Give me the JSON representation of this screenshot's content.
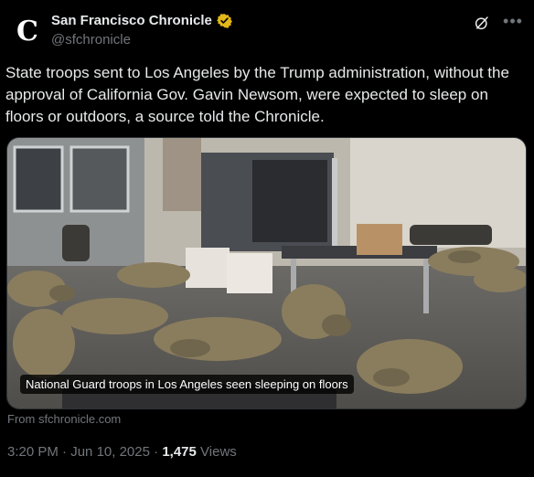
{
  "account": {
    "display_name": "San Francisco Chronicle",
    "handle": "@sfchronicle",
    "avatar_letter": "C",
    "verified": true,
    "verified_color": "#e2b719"
  },
  "icons": {
    "verified": "verified-badge-icon",
    "grok": "grok-icon",
    "more": "more-options-icon"
  },
  "post": {
    "text": "State troops sent to Los Angeles by the Trump administration, without the approval of California Gov. Gavin Newsom, were expected to sleep on floors or outdoors, a source told the Chronicle."
  },
  "media": {
    "caption": "National Guard troops in Los Angeles seen sleeping on floors",
    "source_label": "From sfchronicle.com"
  },
  "meta": {
    "time": "3:20 PM",
    "sep1": "·",
    "date": "Jun 10, 2025",
    "sep2": "·",
    "views_count": "1,475",
    "views_label": "Views"
  }
}
